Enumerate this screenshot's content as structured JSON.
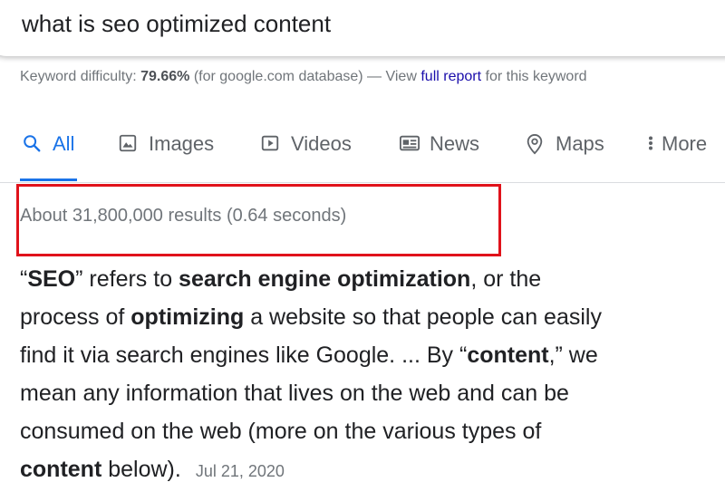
{
  "search": {
    "query": "what is seo optimized content"
  },
  "keyword_difficulty": {
    "label": "Keyword difficulty:",
    "value": "79.66%",
    "database": "(for google.com database) — View",
    "link_text": "full report",
    "suffix": "for this keyword"
  },
  "tabs": [
    {
      "label": "All",
      "icon": "search-icon",
      "active": true
    },
    {
      "label": "Images",
      "icon": "image-icon",
      "active": false
    },
    {
      "label": "Videos",
      "icon": "video-icon",
      "active": false
    },
    {
      "label": "News",
      "icon": "news-icon",
      "active": false
    },
    {
      "label": "Maps",
      "icon": "map-pin-icon",
      "active": false
    },
    {
      "label": "More",
      "icon": "more-vert-icon",
      "active": false
    }
  ],
  "results_stats": "About 31,800,000 results (0.64 seconds)",
  "snippet": {
    "l1_a": "“",
    "l1_b": "SEO",
    "l1_c": "” refers to ",
    "l1_d": "search engine optimization",
    "l1_e": ", or the",
    "l2_a": "process of ",
    "l2_b": "optimizing",
    "l2_c": " a website so that people can easily",
    "l3_a": "find it via search engines like Google. ... By “",
    "l3_b": "content",
    "l3_c": ",” we",
    "l4": "mean any information that lives on the web and can be",
    "l5": "consumed on the web (more on the various types of",
    "l6_a": "content",
    "l6_b": " below).",
    "date": "Jul 21, 2020"
  },
  "colors": {
    "accent": "#1a73e8",
    "highlight_border": "#e0121b",
    "link": "#1a0dab"
  }
}
